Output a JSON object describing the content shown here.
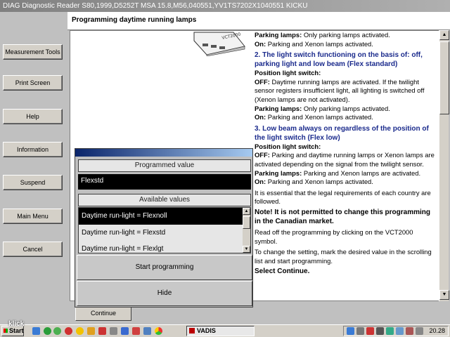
{
  "window": {
    "title": "DIAG Diagnostic Reader S80,1999,D5252T MSA 15.8,M56,040551,YV1TS7202X1040551 KICKU"
  },
  "sidebar": {
    "items": [
      {
        "label": "Measurement Tools"
      },
      {
        "label": "Print Screen"
      },
      {
        "label": "Help"
      },
      {
        "label": "Information"
      },
      {
        "label": "Suspend"
      },
      {
        "label": "Main Menu"
      },
      {
        "label": "Cancel"
      }
    ]
  },
  "header": {
    "title": "Programming daytime running lamps"
  },
  "content": {
    "l1_b": "Parking lamps:",
    "l1": " Only parking lamps activated.",
    "l2_b": "On:",
    "l2": " Parking and Xenon lamps activated.",
    "h2": "2. The light switch functioning on the basis of: off, parking light and low beam (Flex standard)",
    "p2_b": "Position light switch:",
    "p2a_b": "OFF:",
    "p2a": " Daytime running lamps are activated. If the twilight sensor registers insufficient light, all lighting is switched off (Xenon lamps are not activated).",
    "p2b_b": "Parking lamps:",
    "p2b": " Only parking lamps activated.",
    "p2c_b": "On:",
    "p2c": " Parking and Xenon lamps activated.",
    "h3": "3. Low beam always on regardless of the position of the light switch (Flex low)",
    "p3_b": "Position light switch:",
    "p3a_b": "OFF:",
    "p3a": " Parking and daytime running lamps or Xenon lamps are activated depending on the signal from the twilight sensor.",
    "p3b_b": "Parking lamps:",
    "p3b": " Parking and Xenon lamps are activated.",
    "p3c_b": "On:",
    "p3c": " Parking and Xenon lamps activated.",
    "legal": "It is essential that the legal requirements of each country are followed.",
    "note": "Note! It is not permitted to change this programming in the Canadian market.",
    "readoff": "Read off the programming by clicking on the VCT2000 symbol.",
    "change": "To change the setting, mark the desired value in the scrolling list and start programming.",
    "select": "Select Continue.",
    "device_label": "VCT2000"
  },
  "footer": {
    "continue_label": "Continue"
  },
  "dialog": {
    "programmed_label": "Programmed value",
    "programmed_value": "Flexstd",
    "available_label": "Available values",
    "options": [
      "Daytime run-light = Flexnoll",
      "Daytime run-light = Flexstd",
      "Daytime run-light = Flexlgt"
    ],
    "start_label": "Start programming",
    "hide_label": "Hide"
  },
  "taskbar": {
    "start_label": "Start",
    "app_label": "VADIS",
    "clock": "20.28"
  },
  "watermark": "klick"
}
